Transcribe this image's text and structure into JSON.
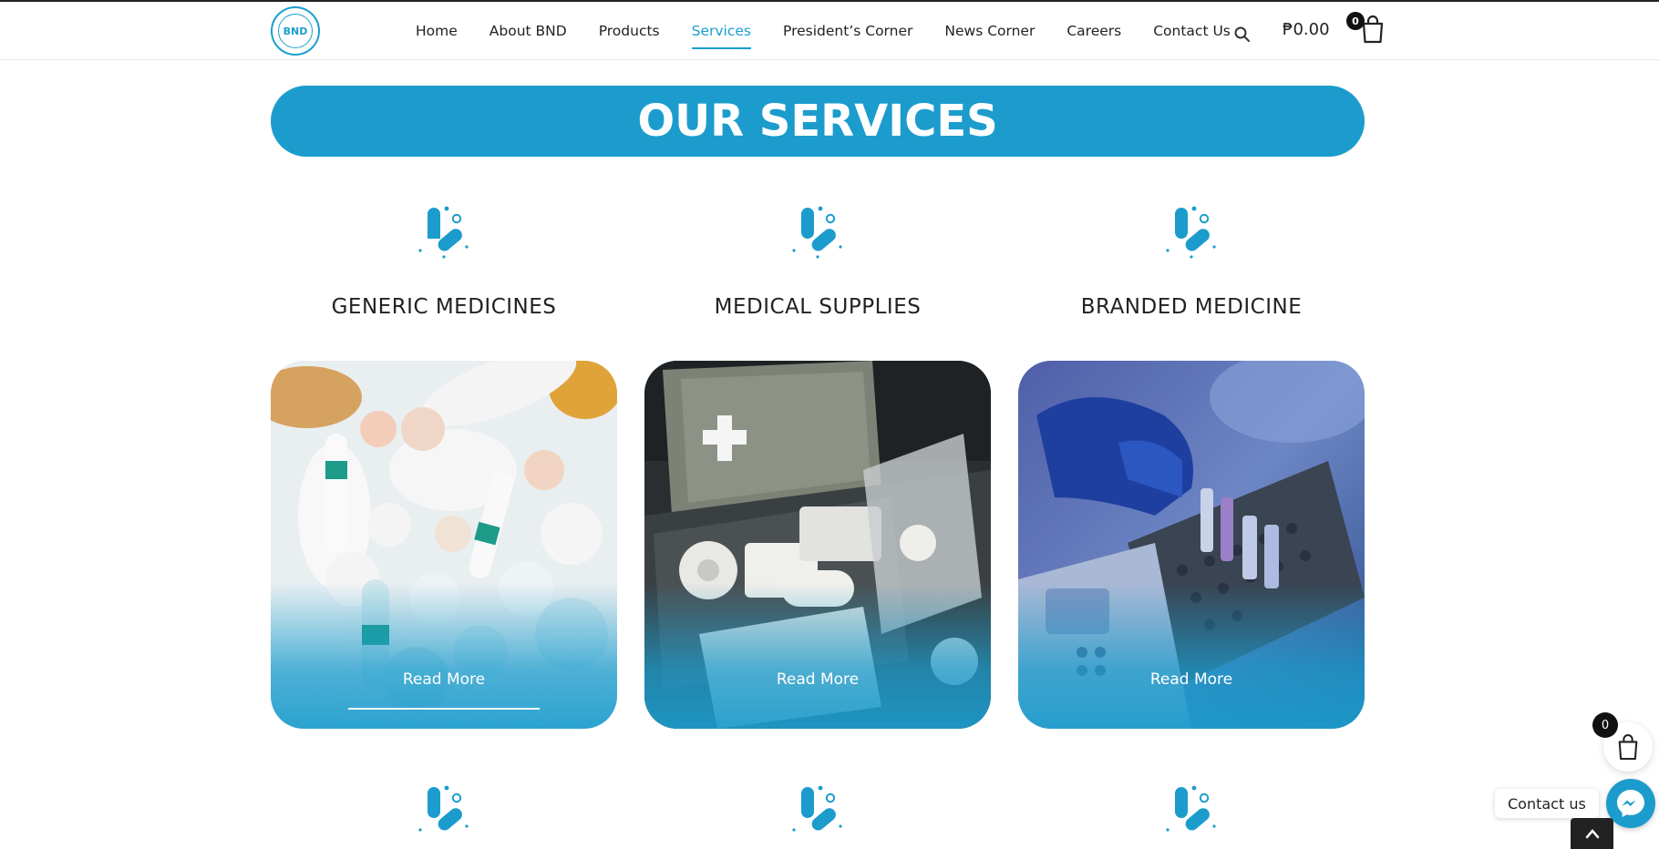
{
  "header": {
    "logo_text": "BND",
    "nav": [
      {
        "label": "Home"
      },
      {
        "label": "About BND"
      },
      {
        "label": "Products"
      },
      {
        "label": "Services",
        "active": true
      },
      {
        "label": "President’s Corner"
      },
      {
        "label": "News Corner"
      },
      {
        "label": "Careers"
      },
      {
        "label": "Contact Us"
      }
    ],
    "cart_total": "₱0.00",
    "cart_count": "0"
  },
  "banner": {
    "title": "OUR SERVICES"
  },
  "services": [
    {
      "title": "GENERIC MEDICINES",
      "cta": "Read More",
      "image": "pills-photo"
    },
    {
      "title": "MEDICAL SUPPLIES",
      "cta": "Read More",
      "image": "first-aid-kit-photo"
    },
    {
      "title": "BRANDED MEDICINE",
      "cta": "Read More",
      "image": "lab-test-tubes-photo"
    }
  ],
  "floating": {
    "cart_count": "0",
    "contact_label": "Contact us"
  },
  "colors": {
    "brand": "#1b9ccd",
    "nav_active": "#1a9ed0",
    "text": "#222222"
  },
  "icons": [
    "search-icon",
    "cart-icon",
    "pill-icon",
    "messenger-icon",
    "chevron-up-icon"
  ]
}
